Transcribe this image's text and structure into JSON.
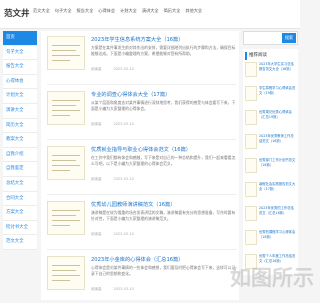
{
  "site": {
    "logo": "范文井"
  },
  "nav": [
    "范文大全",
    "句子大全",
    "报告大全",
    "心得体会",
    "计划大全",
    "演讲大全",
    "简历大全",
    "其他大全"
  ],
  "sidebar": [
    "首页",
    "句子大全",
    "报告大全",
    "心得体会",
    "计划大全",
    "演讲大全",
    "简历大全",
    "教案大全",
    "自我介绍",
    "自我鉴定",
    "总结大全",
    "合同大全",
    "方案大全",
    "检讨书大全",
    "范文大全"
  ],
  "articles": [
    {
      "title": "2023年学生信息系统方案大全（16篇）",
      "desc": "方案是在某件事发生前对其作出的安排，需要详细地列出执行的步骤和方法，确保目标能够达成。下面是小编整理的方案，希望能够对您有所帮助。",
      "date": "2023-03-10",
      "views": "阅读量"
    },
    {
      "title": "专业的调查心得体会大全（17篇）",
      "desc": "从某个层面和角度去对某件事情进行深刻地思考，我们获得的感受与体会要写下来，下面是小编为大家整理的心得体会。",
      "date": "2023-03-10",
      "views": "阅读量"
    },
    {
      "title": "优质就业指导与职业心得体会范文（16篇）",
      "desc": "在工作中我们都有体会和感触，写下来是对自己的一种总结和提升，我们一起来看看怎么写吧，以下是小编为大家整理的心得体会范文。",
      "date": "2023-03-10",
      "views": "阅读量"
    },
    {
      "title": "优秀幼儿园教师演讲稿范文（16篇）",
      "desc": "演讲稿是在较为隆重的场合发表讲话的文稿，演讲稿要有充分的思想准备，写作时要有针对性，下面是小编为大家整理的演讲稿范文。",
      "date": "2023-03-10",
      "views": "阅读量"
    },
    {
      "title": "2023年小金库的心得体会（汇总16篇）",
      "desc": "心得体会是对某件事情的一些体会和感想，我们要及时把心得体会写下来，这样可以记录下自己的思想和变化。",
      "date": "2023-03-10",
      "views": "阅读量"
    }
  ],
  "search": {
    "button": "搜索"
  },
  "right_panel": {
    "title": "推荐阅读",
    "items": [
      "2023年大学生实习总结报告范文大全（16篇）",
      "学生寒假学习心得体会范文（19篇）",
      "优秀周记优秀心得体会（汇总19篇）",
      "2023年优秀教师工作总结范文（16篇）",
      "优秀部门工作计划书范文（16篇）",
      "暑假社会实践报告范文大全（17篇）",
      "2023年优秀的工作总结范文（汇总16篇）",
      "优秀的课程学习心得体会（18篇）",
      "优秀个人年度工作总结范文（汇总16篇）"
    ]
  },
  "watermark": "如图所示",
  "colors": {
    "accent": "#1e88e5",
    "link": "#1a73c8"
  }
}
